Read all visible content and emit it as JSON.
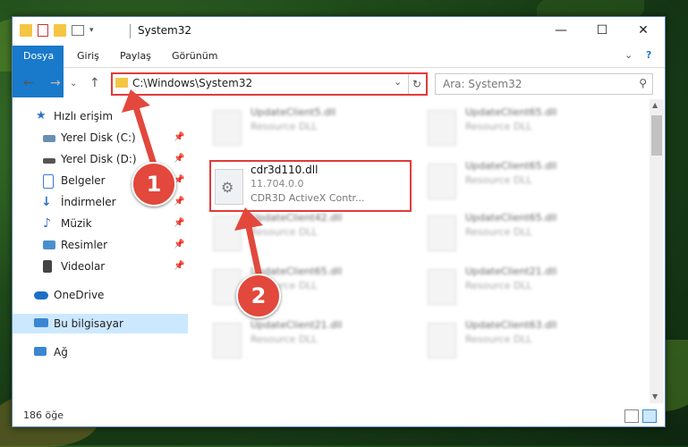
{
  "window": {
    "title": "System32",
    "controls": {
      "minimize": "—",
      "maximize": "☐",
      "close": "✕"
    }
  },
  "ribbon": {
    "tabs": [
      "Dosya",
      "Giriş",
      "Paylaş",
      "Görünüm"
    ],
    "expand": "⌄",
    "help": "?"
  },
  "address": {
    "path": "C:\\Windows\\System32",
    "refresh": "↻",
    "dropdown": "⌄"
  },
  "search": {
    "placeholder": "Ara: System32",
    "icon": "⚲"
  },
  "nav": {
    "quick": "Hızlı erişim",
    "items": [
      {
        "label": "Yerel Disk (C:)",
        "icon": "drive-icon",
        "color": "#6b8fb3"
      },
      {
        "label": "Yerel Disk (D:)",
        "icon": "drive-icon",
        "color": "#555"
      },
      {
        "label": "Belgeler",
        "icon": "documents-icon",
        "color": "#3a7bd5"
      },
      {
        "label": "İndirmeler",
        "icon": "downloads-icon",
        "color": "#2f73c7"
      },
      {
        "label": "Müzik",
        "icon": "music-icon",
        "color": "#3a6fc9"
      },
      {
        "label": "Resimler",
        "icon": "pictures-icon",
        "color": "#4a8fcc"
      },
      {
        "label": "Videolar",
        "icon": "videos-icon",
        "color": "#444"
      }
    ],
    "onedrive": "OneDrive",
    "thispc": "Bu bilgisayar",
    "network": "Ağ"
  },
  "files": {
    "col1": [
      {
        "name": "UpdateClient5.dll",
        "type": "Resource DLL"
      },
      {
        "name": "cdr3d110.dll",
        "type": "11.704.0.0",
        "desc": "CDR3D ActiveX Contr..."
      },
      {
        "name": "UpdateClient42.dll",
        "type": "Resource DLL"
      },
      {
        "name": "UpdateClient65.dll",
        "type": "Resource DLL"
      },
      {
        "name": "UpdateClient21.dll",
        "type": "Resource DLL"
      }
    ],
    "col2": [
      {
        "name": "UpdateClient65.dll",
        "type": "Resource DLL"
      },
      {
        "name": "UpdateClient65.dll",
        "type": "Resource DLL"
      },
      {
        "name": "UpdateClient65.dll",
        "type": "Resource DLL"
      },
      {
        "name": "UpdateClient21.dll",
        "type": "Resource DLL"
      },
      {
        "name": "UpdateClient63.dll",
        "type": "Resource DLL"
      }
    ]
  },
  "status": {
    "count": "186 öğe"
  },
  "badges": {
    "one": "1",
    "two": "2"
  },
  "colors": {
    "accent": "#1979ca",
    "highlight": "#e23a3a",
    "selection": "#cce8ff"
  }
}
